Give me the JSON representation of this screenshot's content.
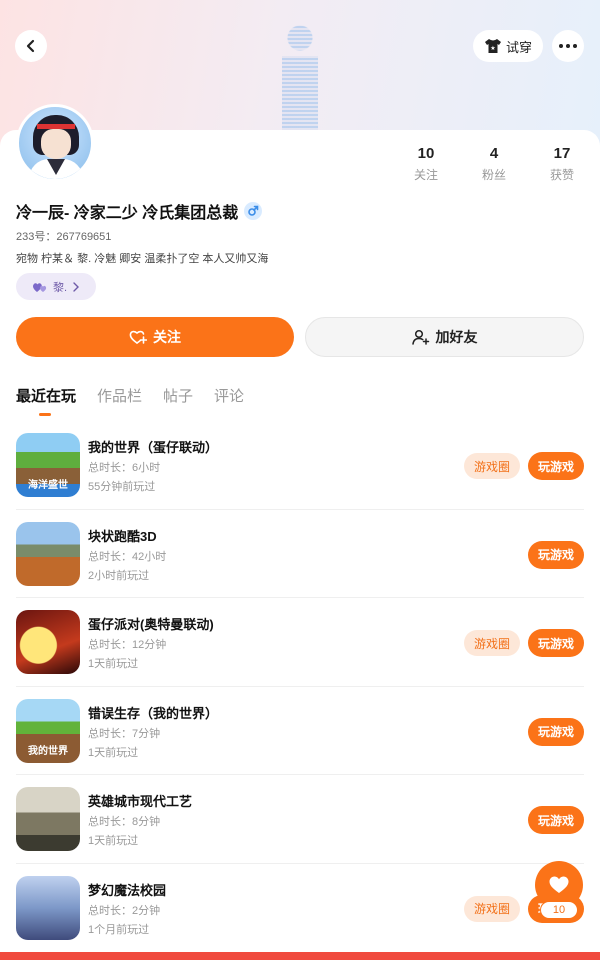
{
  "header": {
    "tryon_label": "试穿"
  },
  "profile": {
    "nickname": "冷一辰- 冷家二少 冷氏集团总裁",
    "uid": "233号：267769651",
    "bio": "宛物 柠某＆ 黎. 冷魅 卿安 温柔扑了空 本人又帅又海",
    "relation_tag": "黎.",
    "stats": [
      {
        "value": "10",
        "label": "关注"
      },
      {
        "value": "4",
        "label": "粉丝"
      },
      {
        "value": "17",
        "label": "获赞"
      }
    ]
  },
  "actions": {
    "follow_label": "关注",
    "add_friend_label": "加好友"
  },
  "tabs": [
    {
      "label": "最近在玩",
      "active": true
    },
    {
      "label": "作品栏",
      "active": false
    },
    {
      "label": "帖子",
      "active": false
    },
    {
      "label": "评论",
      "active": false
    }
  ],
  "games": [
    {
      "name": "我的世界（蛋仔联动）",
      "total_time": "总时长：6小时",
      "last_played": "55分钟前玩过",
      "has_circle": true,
      "icon_text": "海洋盛世"
    },
    {
      "name": "块状跑酷3D",
      "total_time": "总时长：42小时",
      "last_played": "2小时前玩过",
      "has_circle": false,
      "icon_text": ""
    },
    {
      "name": "蛋仔派对(奥特曼联动)",
      "total_time": "总时长：12分钟",
      "last_played": "1天前玩过",
      "has_circle": true,
      "icon_text": ""
    },
    {
      "name": "错误生存（我的世界）",
      "total_time": "总时长：7分钟",
      "last_played": "1天前玩过",
      "has_circle": false,
      "icon_text": "我的世界"
    },
    {
      "name": "英雄城市现代工艺",
      "total_time": "总时长：8分钟",
      "last_played": "1天前玩过",
      "has_circle": false,
      "icon_text": ""
    },
    {
      "name": "梦幻魔法校园",
      "total_time": "总时长：2分钟",
      "last_played": "1个月前玩过",
      "has_circle": true,
      "icon_text": ""
    }
  ],
  "game_buttons": {
    "circle_label": "游戏圈",
    "play_label": "玩游戏"
  },
  "floating": {
    "like_count": "10"
  },
  "colors": {
    "accent": "#fb7318",
    "circle_bg": "#fde7d8",
    "tag_bg": "#eeeaf8"
  }
}
